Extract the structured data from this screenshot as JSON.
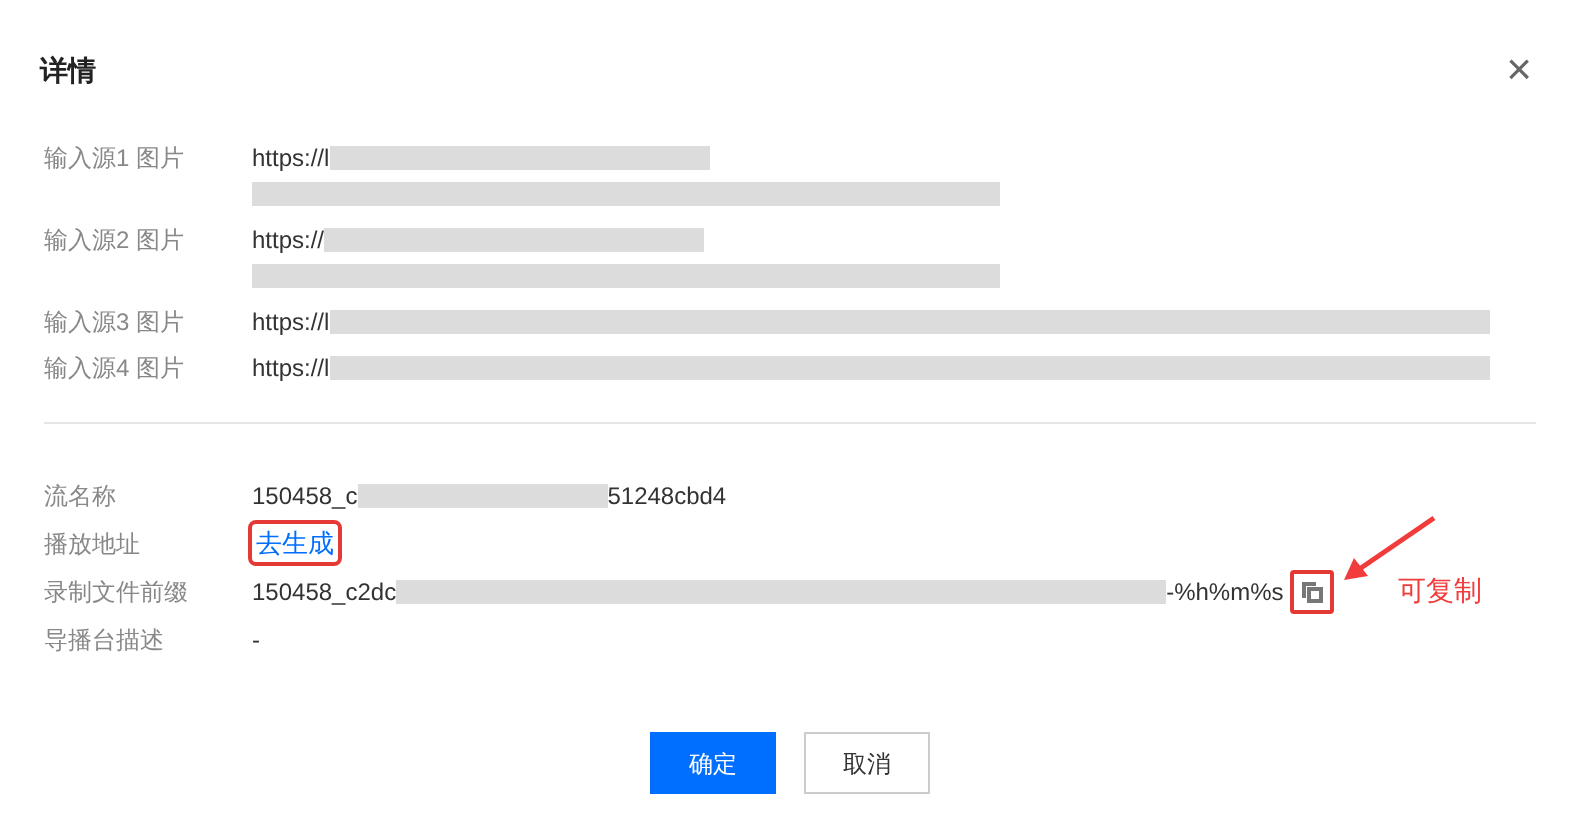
{
  "dialog": {
    "title": "详情",
    "close": "×"
  },
  "sources": [
    {
      "label": "输入源1 图片",
      "lines": [
        {
          "text": "https://l",
          "redacted": true
        },
        {
          "redacted": true
        }
      ]
    },
    {
      "label": "输入源2 图片",
      "lines": [
        {
          "text": "https://",
          "redacted": true
        },
        {
          "redacted": true
        }
      ]
    },
    {
      "label": "输入源3 图片",
      "lines": [
        {
          "text": "https://l",
          "redacted": true
        }
      ]
    },
    {
      "label": "输入源4 图片",
      "lines": [
        {
          "text": "https://l",
          "redacted": true
        }
      ]
    }
  ],
  "fields": [
    {
      "kind": "text",
      "label": "流名称",
      "value": "150458_c",
      "value_end": "51248cbd4",
      "redacted": true
    },
    {
      "kind": "link",
      "label": "播放地址",
      "value": "去生成",
      "highlighted": true
    },
    {
      "kind": "copy",
      "label": "录制文件前缀",
      "value": "150458_c2dc",
      "value_end": "-%h%m%s",
      "redacted": true,
      "highlighted": true,
      "note": "可复制"
    },
    {
      "kind": "text",
      "label": "导播台描述",
      "value": "-"
    }
  ],
  "buttons": [
    {
      "label": "确定",
      "primary": true
    },
    {
      "label": "取消",
      "primary": false
    }
  ]
}
